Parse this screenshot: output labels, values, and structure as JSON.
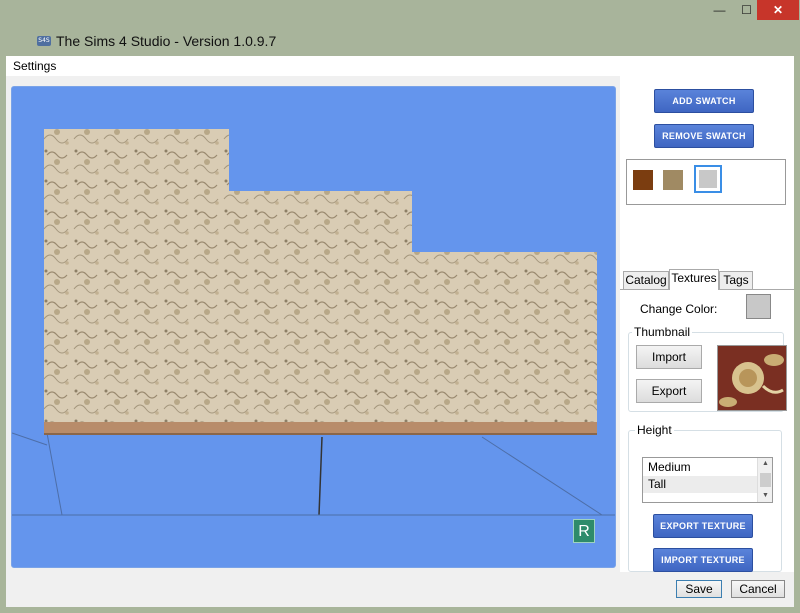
{
  "window": {
    "title": "The Sims 4 Studio - Version 1.0.9.7",
    "icon_text": "S4S",
    "minimize_glyph": "—",
    "maximize_glyph": "☐",
    "close_glyph": "✕"
  },
  "menu": {
    "settings": "Settings"
  },
  "viewport": {
    "badge": "R",
    "background": "#6495ed"
  },
  "toolbar": {
    "add_swatch": "ADD SWATCH",
    "remove_swatch": "REMOVE SWATCH"
  },
  "swatches": [
    {
      "color": "#7b3d10"
    },
    {
      "color": "#a08a63"
    },
    {
      "color": "#c8c8c8",
      "selected": true
    }
  ],
  "tabs": [
    {
      "label": "Catalog"
    },
    {
      "label": "Textures",
      "active": true
    },
    {
      "label": "Tags"
    }
  ],
  "textures": {
    "change_color_label": "Change Color:",
    "thumbnail_title": "Thumbnail",
    "import": "Import",
    "export": "Export",
    "height_title": "Height",
    "height_options": [
      "Medium",
      "Tall"
    ],
    "height_selected": "Tall",
    "export_texture": "EXPORT TEXTURE",
    "import_texture": "IMPORT TEXTURE"
  },
  "footer": {
    "save": "Save",
    "cancel": "Cancel"
  }
}
